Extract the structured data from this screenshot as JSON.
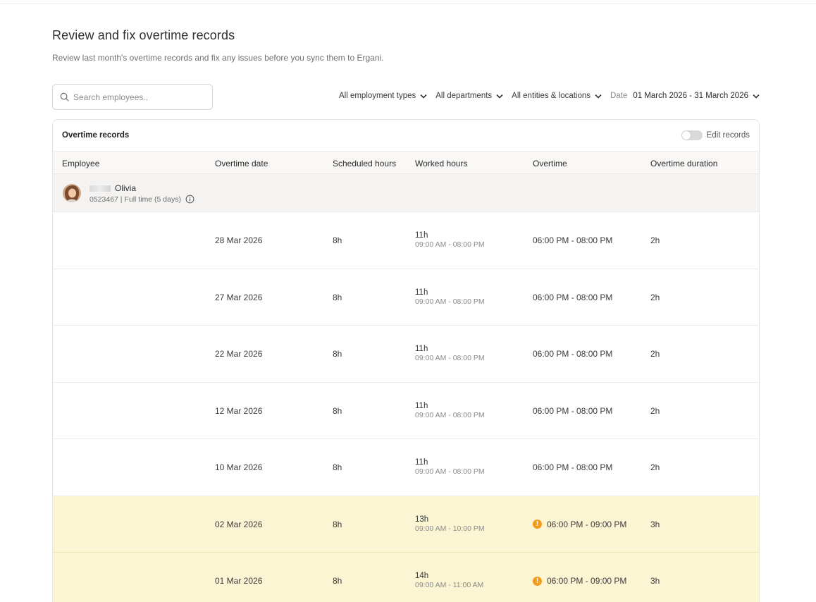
{
  "page": {
    "title": "Review and fix overtime records",
    "subtitle": "Review last month's overtime records and fix any issues before you sync them to Ergani."
  },
  "search": {
    "placeholder": "Search employees.."
  },
  "filters": {
    "employment_types": "All employment types",
    "departments": "All departments",
    "entities": "All entities & locations",
    "date_label": "Date",
    "date_value": "01 March 2026 - 31 March 2026"
  },
  "card": {
    "title": "Overtime records",
    "edit_label": "Edit records",
    "edit_enabled": false
  },
  "columns": [
    "Employee",
    "Overtime date",
    "Scheduled hours",
    "Worked hours",
    "Overtime",
    "Overtime duration"
  ],
  "employee": {
    "name": "Olivia",
    "meta": "0523467 | Full time (5 days)"
  },
  "rows": [
    {
      "date": "28 Mar 2026",
      "scheduled": "8h",
      "worked": "11h",
      "worked_range": "09:00 AM - 08:00 PM",
      "overtime": "06:00 PM - 08:00 PM",
      "duration": "2h",
      "warning": false
    },
    {
      "date": "27 Mar 2026",
      "scheduled": "8h",
      "worked": "11h",
      "worked_range": "09:00 AM - 08:00 PM",
      "overtime": "06:00 PM - 08:00 PM",
      "duration": "2h",
      "warning": false
    },
    {
      "date": "22 Mar 2026",
      "scheduled": "8h",
      "worked": "11h",
      "worked_range": "09:00 AM - 08:00 PM",
      "overtime": "06:00 PM - 08:00 PM",
      "duration": "2h",
      "warning": false
    },
    {
      "date": "12 Mar 2026",
      "scheduled": "8h",
      "worked": "11h",
      "worked_range": "09:00 AM - 08:00 PM",
      "overtime": "06:00 PM - 08:00 PM",
      "duration": "2h",
      "warning": false
    },
    {
      "date": "10 Mar 2026",
      "scheduled": "8h",
      "worked": "11h",
      "worked_range": "09:00 AM - 08:00 PM",
      "overtime": "06:00 PM - 08:00 PM",
      "duration": "2h",
      "warning": false
    },
    {
      "date": "02 Mar 2026",
      "scheduled": "8h",
      "worked": "13h",
      "worked_range": "09:00 AM - 10:00 PM",
      "overtime": "06:00 PM - 09:00 PM",
      "duration": "3h",
      "warning": true
    },
    {
      "date": "01 Mar 2026",
      "scheduled": "8h",
      "worked": "14h",
      "worked_range": "09:00 AM - 11:00 AM",
      "overtime": "06:00 PM - 09:00 PM",
      "duration": "3h",
      "warning": true
    }
  ],
  "colors": {
    "warning_row": "#fcf5d3",
    "warning_icon": "#f39c1a",
    "employee_row": "#f4f3f1",
    "header_row": "#faf8f6"
  },
  "icons": {
    "search": "search-icon",
    "chevron": "chevron-down-icon",
    "info": "info-icon",
    "warning": "warning-icon"
  }
}
